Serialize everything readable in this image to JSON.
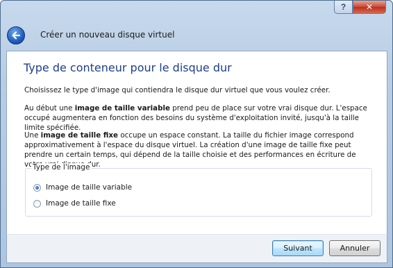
{
  "titlebar": {
    "help_label": "?",
    "close_label": "✕"
  },
  "nav": {
    "title": "Créer un nouveau disque virtuel"
  },
  "main": {
    "heading": "Type de conteneur pour le disque dur",
    "intro": "Choisissez le type d'image qui contiendra le disque dur virtuel que vous voulez créer.",
    "variable_para": {
      "pre": "Au début une ",
      "bold": "image de taille variable",
      "post": " prend peu de place sur votre vrai disque dur. L'espace occupé augmentera en fonction des besoins du système d'exploitation invité, jusqu'à la taille limite spécifiée."
    },
    "fixed_para": {
      "pre": "Une ",
      "bold": "image de taille fixe",
      "post": " occupe un espace constant. La taille du fichier image correspond approximativement à l'espace du disque virtuel. La création d'une image de taille fixe peut prendre un certain temps, qui dépend de la taille choisie et des performances en écriture de votre vrai disque dur."
    },
    "image_type_group": {
      "legend": "Type de l'image",
      "options": [
        {
          "label": "Image de taille variable",
          "checked": true
        },
        {
          "label": "Image de taille fixe",
          "checked": false
        }
      ]
    }
  },
  "footer": {
    "next_label": "Suivant",
    "cancel_label": "Annuler"
  }
}
